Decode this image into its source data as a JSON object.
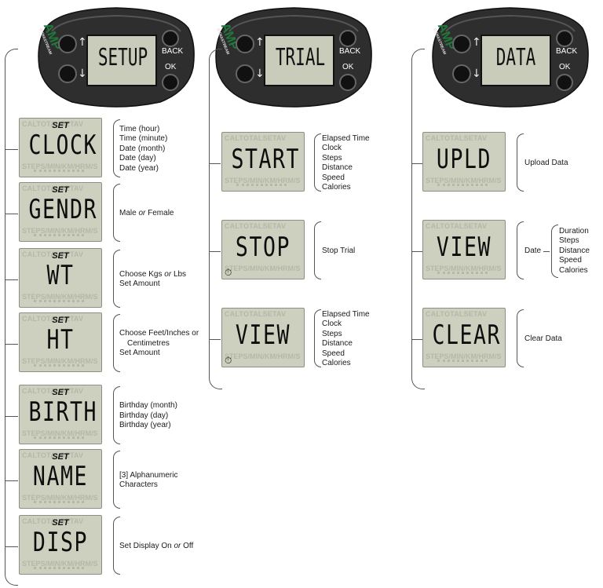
{
  "colors": {
    "lcd_bg": "#cdd0bf",
    "device_body": "#2a2a2a",
    "brand_green": "#1f7a3a"
  },
  "lcd_ghost": {
    "top": "CALTOTALSETAV",
    "bottom": "STEPS/MIN/KM/HRM/S"
  },
  "devices": [
    {
      "brand": "AMP",
      "maker": "DYNASTREAM",
      "screen": "SETUP",
      "back": "BACK",
      "ok": "OK"
    },
    {
      "brand": "AMP",
      "maker": "DYNASTREAM",
      "screen": "TRIAL",
      "back": "BACK",
      "ok": "OK"
    },
    {
      "brand": "AMP",
      "maker": "DYNASTREAM",
      "screen": "DATA",
      "back": "BACK",
      "ok": "OK"
    }
  ],
  "setup": [
    {
      "set": "SET",
      "screen": "CLOCK",
      "items": [
        "Time (hour)",
        "Time (minute)",
        "Date (month)",
        "Date (day)",
        "Date (year)"
      ]
    },
    {
      "set": "SET",
      "screen": "GENDR",
      "items": [
        "Male or Female"
      ]
    },
    {
      "set": "SET",
      "screen": "WT",
      "items": [
        "Choose Kgs or Lbs",
        "Set Amount"
      ]
    },
    {
      "set": "SET",
      "screen": "HT",
      "items": [
        "Choose Feet/Inches or",
        "Centimetres",
        "Set Amount"
      ]
    },
    {
      "set": "SET",
      "screen": "BIRTH",
      "items": [
        "Birthday (month)",
        "Birthday (day)",
        "Birthday (year)"
      ]
    },
    {
      "set": "SET",
      "screen": "NAME",
      "items": [
        "[3] Alphanumeric",
        "Characters"
      ]
    },
    {
      "set": "SET",
      "screen": "DISP",
      "items": [
        "Set Display On or Off"
      ]
    }
  ],
  "trial": [
    {
      "screen": "START",
      "items": [
        "Elapsed Time",
        "Clock",
        "Steps",
        "Distance",
        "Speed",
        "Calories"
      ]
    },
    {
      "screen": "STOP",
      "timer": "⏱",
      "items": [
        "Stop Trial"
      ]
    },
    {
      "screen": "VIEW",
      "timer": "⏱",
      "items": [
        "Elapsed Time",
        "Clock",
        "Steps",
        "Distance",
        "Speed",
        "Calories"
      ]
    }
  ],
  "data": [
    {
      "screen": "UPLD",
      "items": [
        "Upload Data"
      ]
    },
    {
      "screen": "VIEW",
      "label": "Date",
      "items": [
        "Duration",
        "Steps",
        "Distance",
        "Speed",
        "Calories"
      ]
    },
    {
      "screen": "CLEAR",
      "items": [
        "Clear Data"
      ]
    }
  ]
}
